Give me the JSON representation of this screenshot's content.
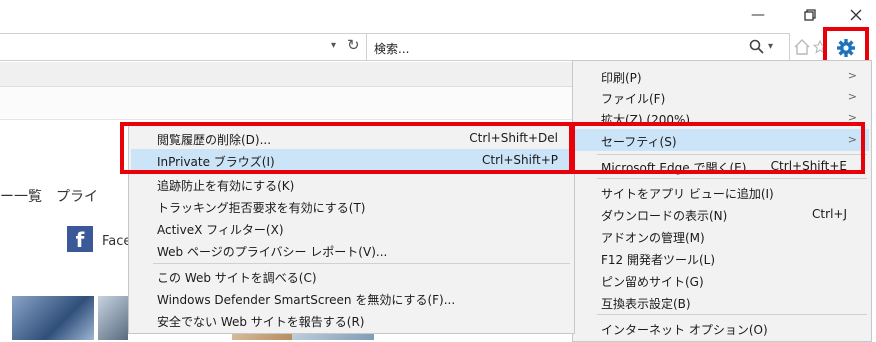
{
  "window": {
    "minimize_icon": "minimize-icon",
    "restore_icon": "restore-icon",
    "close_icon": "close-icon"
  },
  "address_bar": {
    "dropdown_glyph": "▾",
    "refresh_glyph": "↻"
  },
  "search": {
    "placeholder": "検索...",
    "dropdown": "▾"
  },
  "page": {
    "nav_text": "ー一覧　プライ",
    "facebook_label": "Face"
  },
  "gear_menu": {
    "items": [
      {
        "label": "印刷(P)",
        "arrow": ">"
      },
      {
        "label": "ファイル(F)",
        "arrow": ">"
      },
      {
        "label": "拡大(Z) (200%)",
        "arrow": ">"
      },
      {
        "label": "セーフティ(S)",
        "arrow": ">"
      },
      {
        "label": "Microsoft Edge で開く(E)",
        "shortcut": "Ctrl+Shift+E"
      },
      {
        "label": "サイトをアプリ ビューに追加(I)"
      },
      {
        "label": "ダウンロードの表示(N)",
        "shortcut": "Ctrl+J"
      },
      {
        "label": "アドオンの管理(M)"
      },
      {
        "label": "F12 開発者ツール(L)"
      },
      {
        "label": "ピン留めサイト(G)"
      },
      {
        "label": "互換表示設定(B)"
      },
      {
        "label": "インターネット オプション(O)"
      }
    ]
  },
  "safety_submenu": {
    "items": [
      {
        "label": "閲覧履歴の削除(D)...",
        "shortcut": "Ctrl+Shift+Del"
      },
      {
        "label": "InPrivate ブラウズ(I)",
        "shortcut": "Ctrl+Shift+P"
      },
      {
        "label": "追跡防止を有効にする(K)"
      },
      {
        "label": "トラッキング拒否要求を有効にする(T)"
      },
      {
        "label": "ActiveX フィルター(X)"
      },
      {
        "label": "Web ページのプライバシー レポート(V)..."
      },
      {
        "label": "この Web サイトを調べる(C)"
      },
      {
        "label": "Windows Defender SmartScreen を無効にする(F)..."
      },
      {
        "label": "安全でない Web サイトを報告する(R)"
      }
    ]
  },
  "colors": {
    "annotation": "#e8000b",
    "highlight": "#cce4f7",
    "gear": "#1e73be"
  }
}
